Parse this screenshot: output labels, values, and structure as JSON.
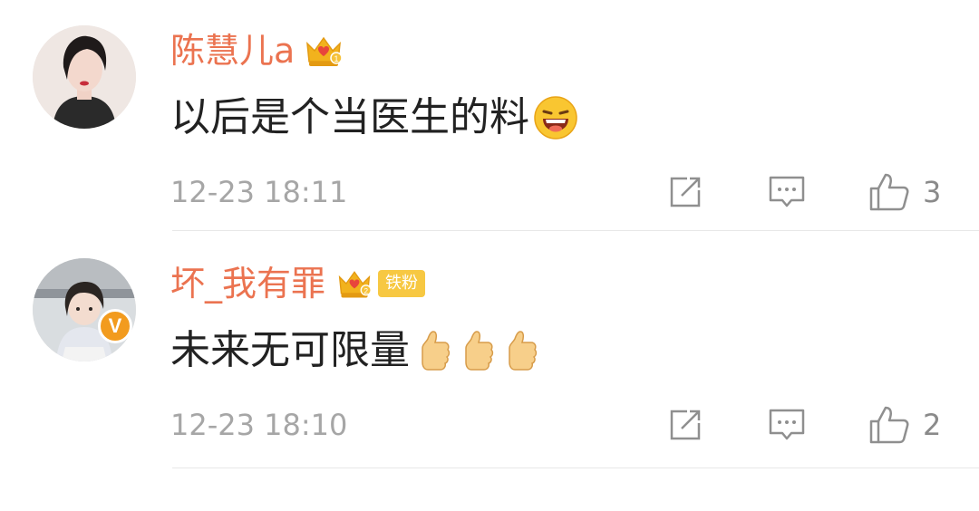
{
  "comments": [
    {
      "username": "陈慧儿a",
      "text": "以后是个当医生的料",
      "time": "12-23 18:11",
      "likes": "3",
      "emoji_icons": [
        "laughing-face-icon"
      ],
      "badge_icon": "crown-badge-icon",
      "colors": {
        "name": "#eb7350",
        "crown": "#f2b21d"
      }
    },
    {
      "username": "坏_我有罪",
      "text": "未来无可限量",
      "time": "12-23 18:10",
      "likes": "2",
      "fan_badge": "铁粉",
      "emoji_icons": [
        "thumbs-up-icon",
        "thumbs-up-icon",
        "thumbs-up-icon"
      ],
      "badge_icon": "crown-badge-icon",
      "verified_mark": "V",
      "colors": {
        "name": "#eb7350",
        "crown": "#f2b21d",
        "verified": "#f29b1e"
      }
    }
  ]
}
